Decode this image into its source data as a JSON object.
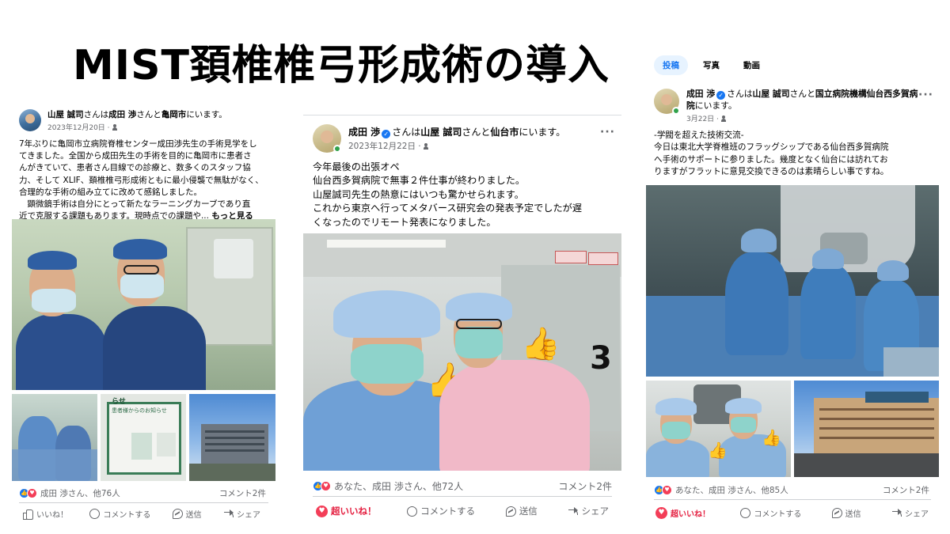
{
  "page": {
    "title": "MIST頚椎椎弓形成術の導入"
  },
  "colors": {
    "brand_blue": "#1877f2",
    "text_secondary": "#65676b",
    "super_like_red": "#e41e3f",
    "verified_blue": "#1877f2"
  },
  "post1": {
    "author": "山屋 誠司",
    "connector": "さんは",
    "with": "成田 渉",
    "connector2": "さんと",
    "place": "亀岡市",
    "suffix": "にいます。",
    "date": "2023年12月20日 ·",
    "text_lines": [
      "7年ぶりに亀岡市立病院脊椎センター成田渉先生の手術見学をし",
      "てきました。全国から成田先生の手術を目的に亀岡市に患者さ",
      "んがきていて、患者さん目線での診療と、数多くのスタッフ協",
      "力、そして XLIF、頚椎椎弓形成術ともに最小侵襲で無駄がなく、",
      "合理的な手術の組み立てに改めて感銘しました。",
      "　顕微鏡手術は自分にとって新たなラーニングカーブであり直",
      "近で克服する課題もあります。現時点での課題や..."
    ],
    "see_more": "もっと見る",
    "reactions": "成田 渉さん、他76人",
    "comments": "コメント2件",
    "actions": {
      "like": "いいね！",
      "comment": "コメントする",
      "send": "送信",
      "share": "シェア"
    },
    "sign_text": "お知らせ",
    "sign_text2": "患者様からのお知らせ",
    "sign_corner": "らせ"
  },
  "post2": {
    "author": "成田 渉",
    "connector": "さんは",
    "with": "山屋 誠司",
    "connector2": "さんと",
    "place": "仙台市",
    "suffix": "にいます。",
    "date": "2023年12月22日 ·",
    "text_lines": [
      "今年最後の出張オペ",
      "仙台西多賀病院で無事２件仕事が終わりました。",
      "山屋誠司先生の熱意にはいつも驚かせられます。",
      "これから東京へ行ってメタバース研究会の発表予定でしたが遅",
      "くなったのでリモート発表になりました。"
    ],
    "room_number": "3",
    "reactions": "あなた、成田 渉さん、他72人",
    "comments": "コメント2件",
    "actions": {
      "super": "超いいね！",
      "comment": "コメントする",
      "send": "送信",
      "share": "シェア"
    }
  },
  "post3": {
    "tabs": [
      "投稿",
      "写真",
      "動画"
    ],
    "author": "成田 渉",
    "connector": "さんは",
    "with": "山屋 誠司",
    "connector2": "さんと",
    "place": "国立病院機構仙台西多賀病院",
    "suffix": "にいます。",
    "date": "3月22日 ·",
    "text_lines": [
      "-学閥を超えた技術交流-",
      "今日は東北大学脊椎班のフラッグシップである仙台西多賀病院",
      "へ手術のサポートに参りました。幾度となく仙台には訪れてお",
      "りますがフラットに意見交換できるのは素晴らしい事ですね。"
    ],
    "reactions": "あなた、成田 渉さん、他85人",
    "comments": "コメント2件",
    "actions": {
      "super": "超いいね！",
      "comment": "コメントする",
      "send": "送信",
      "share": "シェア"
    }
  }
}
